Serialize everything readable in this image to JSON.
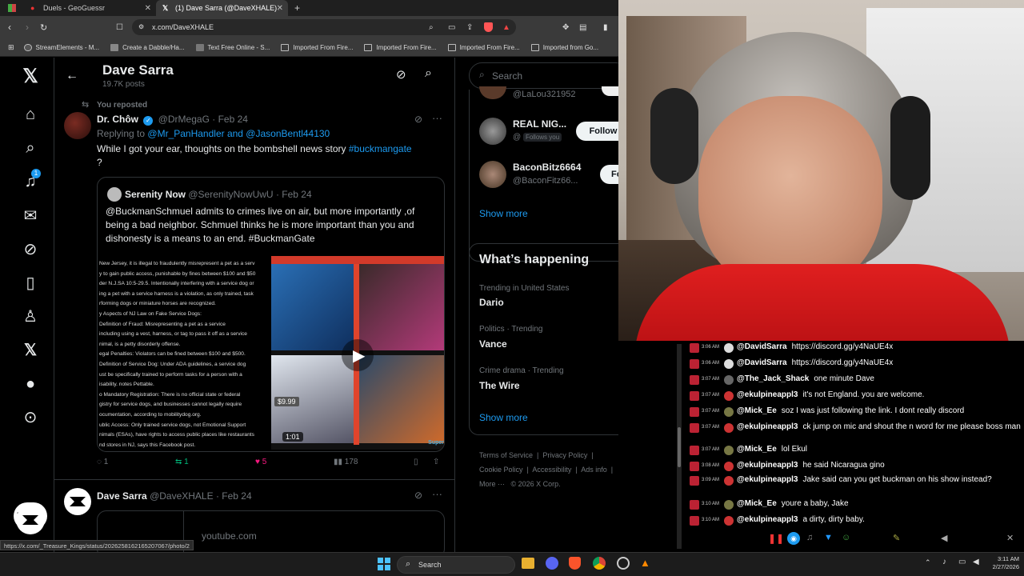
{
  "browser": {
    "tabs": [
      {
        "label": "Duels - GeoGuessr"
      },
      {
        "label": "(1) Dave Sarra (@DaveXHALE) / X"
      }
    ],
    "url": "x.com/DaveXHALE",
    "bookmarks": [
      "StreamElements - M...",
      "Create a Dabble/Ha...",
      "Text Free Online - S...",
      "Imported From Fire...",
      "Imported From Fire...",
      "Imported From Fire...",
      "Imported from Go..."
    ],
    "status_url": "https://x.com/_Treasure_Kings/status/2026258162165207067/photo/2"
  },
  "left_nav": {
    "notif_count": "1",
    "tweet_label": "Tweet"
  },
  "profile_header": {
    "name": "Dave Sarra",
    "posts": "19.7K posts"
  },
  "tweet1": {
    "repost_label": "You reposted",
    "author_name": "Dr. Chôw",
    "author_handle": "@DrMegaG",
    "date": "· Feb 24",
    "replying_prefix": "Replying to",
    "replying_to": "@Mr_PanHandler and @JasonBentl44130",
    "text": "While I got your ear, thoughts on the bombshell news story",
    "hashtag": "#buckmangate",
    "trail": "?",
    "quote": {
      "author_name": "Serenity Now",
      "author_handle": "@SerenityNowUwU",
      "date": "· Feb 24",
      "text": "@BuckmanSchmuel admits to crimes live on air, but more importantly ,of being a bad neighbor. Schmuel thinks he is more important than you and dishonesty is a means to an end. #BuckmanGate",
      "doc_lines": [
        "New Jersey, it is illegal to fraudulently misrepresent a pet as a serv",
        "y to gain public access, punishable by fines between $100 and $50",
        "der N.J.SA 10:5-29.5. Intentionally interfering with a service dog or",
        "ing a pet with a service harness is a violation, as only trained, task",
        "rforming dogs or miniature horses are recognized.",
        "y Aspects of NJ Law on Fake Service Dogs:",
        "Definition of Fraud: Misrepresenting a pet as a service",
        "including using a vest, harness, or tag to pass it off as a service",
        "nimal, is a petty disorderly offense.",
        "egal Penalties: Violators can be fined between $100 and $500.",
        "Definition of Service Dog: Under ADA guidelines, a service dog",
        "ust be specifically trained to perform tasks for a person with a",
        "isability. notes Pettable.",
        "o Mandatory Registration: There is no official state or federal",
        "gistry for service dogs, and businesses cannot legally require",
        "ocumentation, according to mobilitydog.org.",
        "ublic Access: Only trained service dogs, not Emotional Support",
        "nimals (ESAs), have rights to access public places like restaurants",
        "nd stores in NJ, says this Facebook post."
      ],
      "price_tag": "$9.99",
      "video_time": "1:01",
      "video_brand": "Super"
    },
    "stats": {
      "replies": "1",
      "reposts": "1",
      "likes": "5",
      "views": "178"
    }
  },
  "tweet2": {
    "author_name": "Dave Sarra",
    "author_handle": "@DaveXHALE",
    "date": "· Feb 24",
    "link_domain": "youtube.com"
  },
  "sidebar": {
    "search_placeholder": "Search",
    "partial_handle": "@LaLou321952",
    "who_to_follow": [
      {
        "name": "REAL NIG...",
        "sub": "@",
        "badge": "Follows you",
        "button": "Follow"
      },
      {
        "name": "BaconBitz6664",
        "sub": "@BaconFitz66...",
        "button": "Fo"
      }
    ],
    "show_more": "Show more",
    "happening_title": "What’s happening",
    "trends": [
      {
        "context": "Trending in United States",
        "name": "Dario"
      },
      {
        "context": "Politics · Trending",
        "name": "Vance"
      },
      {
        "context": "Crime drama · Trending",
        "name": "The Wire"
      }
    ],
    "show_more_2": "Show more",
    "footer": {
      "links": [
        "Terms of Service",
        "Privacy Policy",
        "Cookie Policy",
        "Accessibility",
        "Ads info",
        "More ···"
      ],
      "copyright": "© 2026 X Corp."
    }
  },
  "chat": {
    "messages": [
      {
        "time": "3:06 AM",
        "user": "@DavidSarra",
        "text": "https://discord.gg/y4NaUE4x",
        "av": "#ddd"
      },
      {
        "time": "3:06 AM",
        "user": "@DavidSarra",
        "text": "https://discord.gg/y4NaUE4x",
        "av": "#ddd"
      },
      {
        "time": "3:07 AM",
        "user": "@The_Jack_Shack",
        "text": "one minute Dave",
        "av": "#666"
      },
      {
        "time": "3:07 AM",
        "user": "@ekulpineappl3",
        "text": "it's not England. you are welcome.",
        "av": "#c33"
      },
      {
        "time": "3:07 AM",
        "user": "@Mick_Ee",
        "text": "soz I was just following the link. I dont really discord",
        "av": "#774"
      },
      {
        "time": "3:07 AM",
        "user": "@ekulpineappl3",
        "text": "ck jump on mic and shout the n word for me please boss man",
        "av": "#c33"
      },
      {
        "time": "3:07 AM",
        "user": "@Mick_Ee",
        "text": "lol Ekul",
        "av": "#774"
      },
      {
        "time": "3:08 AM",
        "user": "@ekulpineappl3",
        "text": "he said Nicaragua gino",
        "av": "#c33"
      },
      {
        "time": "3:09 AM",
        "user": "@ekulpineappl3",
        "text": "Jake said can you get buckman on his show instead?",
        "av": "#c33"
      },
      {
        "time": "3:10 AM",
        "user": "@Mick_Ee",
        "text": "youre a baby, Jake",
        "av": "#774"
      },
      {
        "time": "3:10 AM",
        "user": "@ekulpineappl3",
        "text": "a dirty, dirty baby.",
        "av": "#c33"
      }
    ]
  },
  "taskbar": {
    "search_label": "Search",
    "time": "3:11 AM",
    "date": "2/27/2026"
  }
}
